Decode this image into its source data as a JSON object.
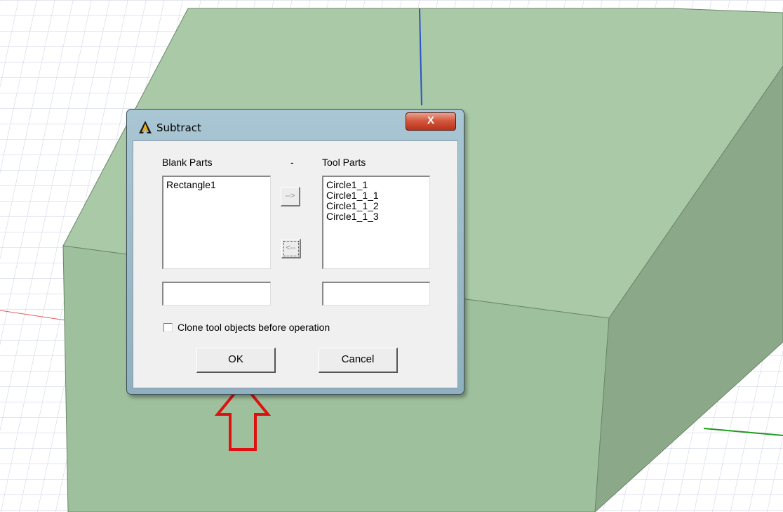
{
  "dialog": {
    "title": "Subtract",
    "close_label": "X",
    "blank_parts_label": "Blank Parts",
    "separator_label": "-",
    "tool_parts_label": "Tool Parts",
    "blank_parts": [
      "Rectangle1"
    ],
    "tool_parts": [
      "Circle1_1",
      "Circle1_1_1",
      "Circle1_1_2",
      "Circle1_1_3"
    ],
    "move_right_label": "-->",
    "move_left_label": "<--",
    "blank_filter_value": "",
    "tool_filter_value": "",
    "clone_label": "Clone tool objects before operation",
    "clone_checked": false,
    "ok_label": "OK",
    "cancel_label": "Cancel"
  },
  "icons": {
    "app_logo": "ansys-logo-icon",
    "annotation_arrows": "red-up-arrow-icon"
  },
  "colors": {
    "model_face_top": "#a9c9a7",
    "model_face_front": "#9fc09d",
    "model_face_right": "#8ba989",
    "annotation_red": "#e01010",
    "axis_blue": "#2e52c8",
    "axis_green": "#1e9a1e",
    "axis_red": "#e06060"
  }
}
